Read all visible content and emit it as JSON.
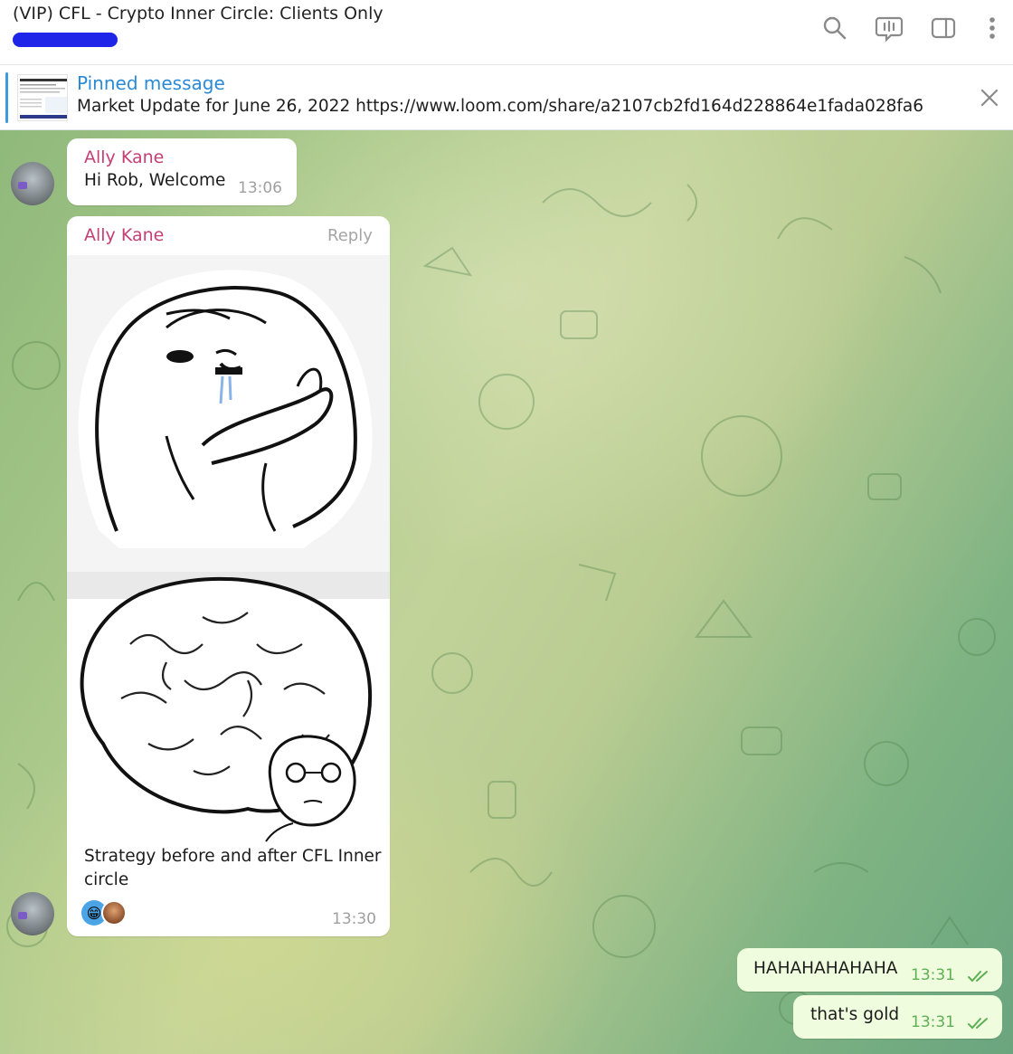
{
  "header": {
    "title": "(VIP) CFL - Crypto Inner Circle: Clients Only",
    "buttons": [
      "search-icon",
      "voice-chat-icon",
      "sidebar-toggle-icon",
      "more-options-icon"
    ]
  },
  "pinned": {
    "label": "Pinned message",
    "text": "Market Update for June 26, 2022  https://www.loom.com/share/a2107cb2fd164d228864e1fada028fa6"
  },
  "messages": [
    {
      "sender": "Ally Kane",
      "text": "Hi Rob, Welcome",
      "time": "13:06"
    },
    {
      "sender": "Ally Kane",
      "reply_label": "Reply",
      "caption_line1": "Strategy before and after CFL Inner",
      "caption_line2": "circle",
      "time": "13:30",
      "reaction_emoji": "😁"
    }
  ],
  "outgoing": [
    {
      "text": "HAHAHAHAHAHA",
      "time": "13:31"
    },
    {
      "text": "that's gold",
      "time": "13:31"
    }
  ],
  "colors": {
    "accent": "#2a8ad6",
    "sender": "#c53f73",
    "outgoing_bg": "#effdde",
    "check": "#5faf55"
  }
}
